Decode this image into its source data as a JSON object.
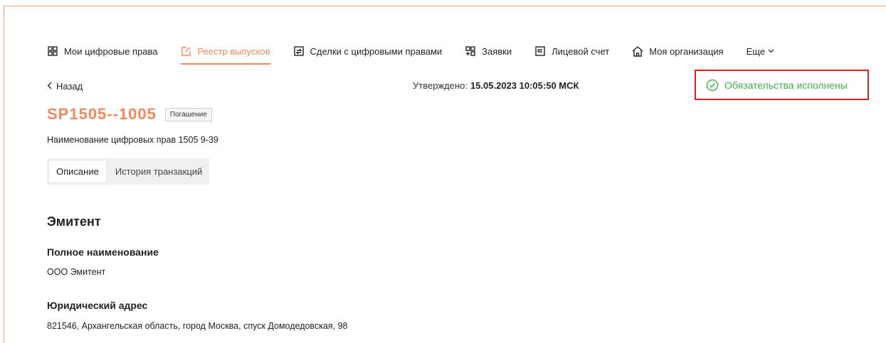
{
  "nav": {
    "items": [
      {
        "label": "Мои цифровые права",
        "icon": "grid-icon"
      },
      {
        "label": "Реестр выпусков",
        "icon": "edit-icon"
      },
      {
        "label": "Сделки с цифровыми правами",
        "icon": "exchange-icon"
      },
      {
        "label": "Заявки",
        "icon": "add-grid-icon"
      },
      {
        "label": "Лицевой счет",
        "icon": "account-icon"
      },
      {
        "label": "Моя организация",
        "icon": "home-icon"
      }
    ],
    "more_label": "Еще",
    "active_color": "#f08a5d"
  },
  "back_label": "Назад",
  "approved": {
    "label": "Утверждено:",
    "value": "15.05.2023 10:05:50 МСК"
  },
  "status": {
    "label": "Обязательства исполнены",
    "color": "#3cb34a",
    "highlight_color": "#e02020"
  },
  "title": "SP1505--1005",
  "badge": "Погашение",
  "subtitle": "Наименование цифровых прав 1505 9-39",
  "tabs": [
    {
      "label": "Описание",
      "active": true
    },
    {
      "label": "История транзакций",
      "active": false
    }
  ],
  "section": {
    "title": "Эмитент",
    "fields": [
      {
        "label": "Полное наименование",
        "value": "ООО Эмитент"
      },
      {
        "label": "Юридический адрес",
        "value": "821546, Архангельская область, город Москва, спуск Домодедовская, 98"
      }
    ]
  }
}
